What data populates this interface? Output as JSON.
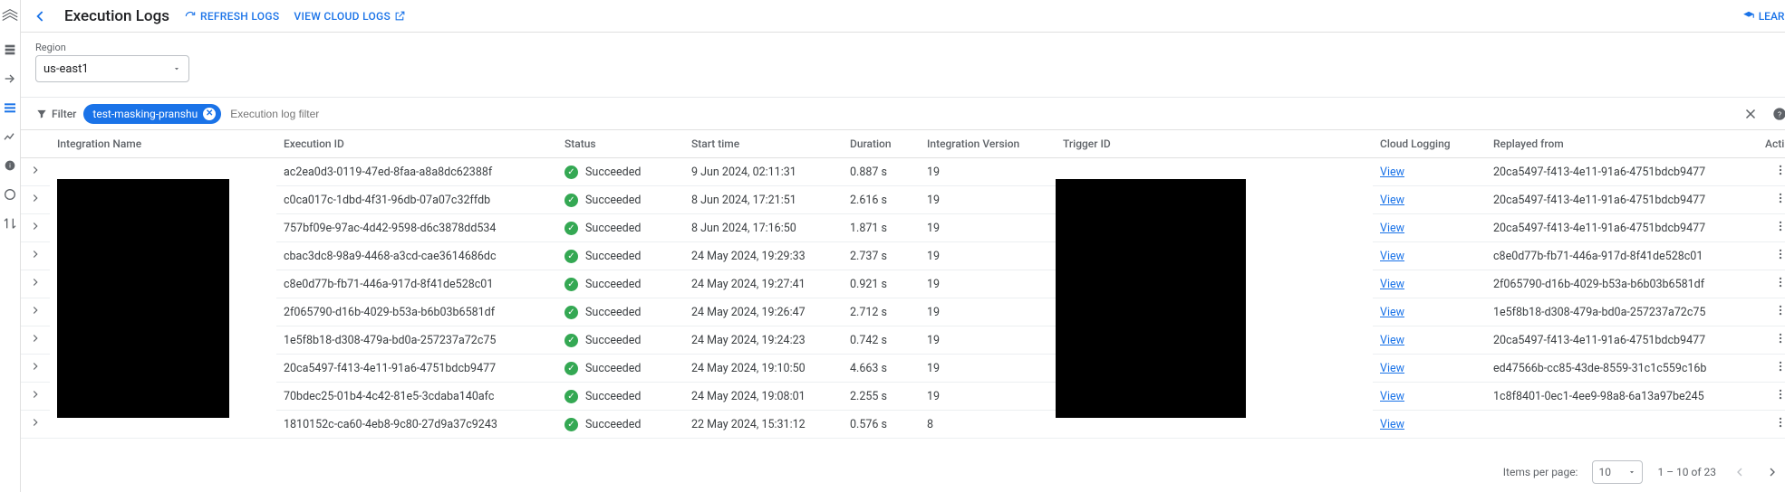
{
  "header": {
    "title": "Execution Logs",
    "refresh_label": "REFRESH LOGS",
    "view_cloud_logs_label": "VIEW CLOUD LOGS",
    "learn_label": "LEARN"
  },
  "region": {
    "label": "Region",
    "value": "us-east1"
  },
  "filter": {
    "label": "Filter",
    "chip_text": "test-masking-pranshu",
    "placeholder": "Execution log filter"
  },
  "columns": {
    "integration_name": "Integration Name",
    "execution_id": "Execution ID",
    "status": "Status",
    "start_time": "Start time",
    "duration": "Duration",
    "integration_version": "Integration Version",
    "trigger_id": "Trigger ID",
    "cloud_logging": "Cloud Logging",
    "replayed_from": "Replayed from",
    "actions": "Actions"
  },
  "status_text": "Succeeded",
  "view_text": "View",
  "rows": [
    {
      "exec": "ac2ea0d3-0119-47ed-8faa-a8a8dc62388f",
      "start": "9 Jun 2024, 02:11:31",
      "dur": "0.887 s",
      "ver": "19",
      "replay": "20ca5497-f413-4e11-91a6-4751bdcb9477"
    },
    {
      "exec": "c0ca017c-1dbd-4f31-96db-07a07c32ffdb",
      "start": "8 Jun 2024, 17:21:51",
      "dur": "2.616 s",
      "ver": "19",
      "replay": "20ca5497-f413-4e11-91a6-4751bdcb9477"
    },
    {
      "exec": "757bf09e-97ac-4d42-9598-d6c3878dd534",
      "start": "8 Jun 2024, 17:16:50",
      "dur": "1.871 s",
      "ver": "19",
      "replay": "20ca5497-f413-4e11-91a6-4751bdcb9477"
    },
    {
      "exec": "cbac3dc8-98a9-4468-a3cd-cae3614686dc",
      "start": "24 May 2024, 19:29:33",
      "dur": "2.737 s",
      "ver": "19",
      "replay": "c8e0d77b-fb71-446a-917d-8f41de528c01"
    },
    {
      "exec": "c8e0d77b-fb71-446a-917d-8f41de528c01",
      "start": "24 May 2024, 19:27:41",
      "dur": "0.921 s",
      "ver": "19",
      "replay": "2f065790-d16b-4029-b53a-b6b03b6581df"
    },
    {
      "exec": "2f065790-d16b-4029-b53a-b6b03b6581df",
      "start": "24 May 2024, 19:26:47",
      "dur": "2.712 s",
      "ver": "19",
      "replay": "1e5f8b18-d308-479a-bd0a-257237a72c75"
    },
    {
      "exec": "1e5f8b18-d308-479a-bd0a-257237a72c75",
      "start": "24 May 2024, 19:24:23",
      "dur": "0.742 s",
      "ver": "19",
      "replay": "20ca5497-f413-4e11-91a6-4751bdcb9477"
    },
    {
      "exec": "20ca5497-f413-4e11-91a6-4751bdcb9477",
      "start": "24 May 2024, 19:10:50",
      "dur": "4.663 s",
      "ver": "19",
      "replay": "ed47566b-cc85-43de-8559-31c1c559c16b"
    },
    {
      "exec": "70bdec25-01b4-4c42-81e5-3cdaba140afc",
      "start": "24 May 2024, 19:08:01",
      "dur": "2.255 s",
      "ver": "19",
      "replay": "1c8f8401-0ec1-4ee9-98a8-6a13a97be245"
    },
    {
      "exec": "1810152c-ca60-4eb8-9c80-27d9a37c9243",
      "start": "22 May 2024, 15:31:12",
      "dur": "0.576 s",
      "ver": "8",
      "replay": ""
    }
  ],
  "pager": {
    "items_per_page_label": "Items per page:",
    "items_per_page_value": "10",
    "range_text": "1 – 10 of 23"
  }
}
